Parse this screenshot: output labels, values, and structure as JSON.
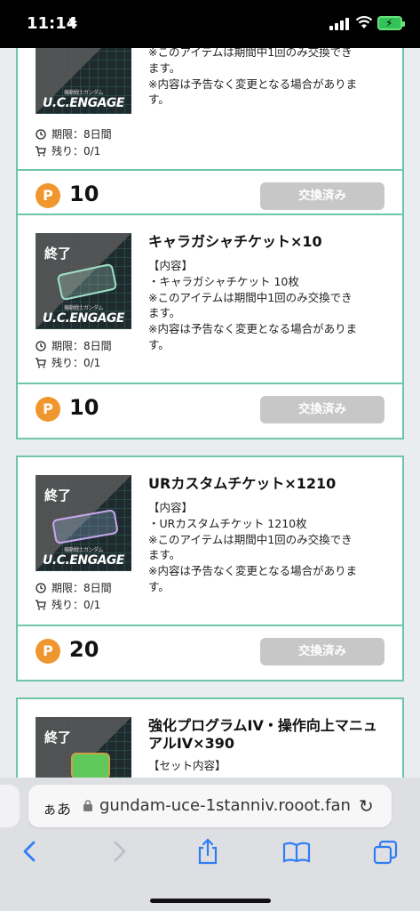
{
  "status": {
    "time": "11:14"
  },
  "cards": [
    {
      "id": "card1",
      "thumb_end_label": "",
      "thumb_logo": "U.C.ENGAGE",
      "thumb_logo_small": "機動戦士ガンダム",
      "title": "",
      "desc": [
        "※このアイテムは期間中1回のみ交換でき",
        "ます。",
        "※内容は予告なく変更となる場合がありま",
        "す。"
      ],
      "period": "期限：8日間",
      "remaining": "残り：0/1",
      "points": "10",
      "button": "交換済み"
    },
    {
      "id": "card2",
      "thumb_end_label": "終了",
      "thumb_logo": "U.C.ENGAGE",
      "thumb_logo_small": "機動戦士ガンダム",
      "title": "キャラガシャチケット×10",
      "desc": [
        "【内容】",
        "・キャラガシャチケット 10枚",
        "※このアイテムは期間中1回のみ交換でき",
        "ます。",
        "※内容は予告なく変更となる場合がありま",
        "す。"
      ],
      "period": "期限：8日間",
      "remaining": "残り：0/1",
      "points": "10",
      "button": "交換済み"
    },
    {
      "id": "card3",
      "thumb_end_label": "終了",
      "thumb_logo": "U.C.ENGAGE",
      "thumb_logo_small": "機動戦士ガンダム",
      "title": "URカスタムチケット×1210",
      "desc": [
        "【内容】",
        "・URカスタムチケット 1210枚",
        "※このアイテムは期間中1回のみ交換でき",
        "ます。",
        "※内容は予告なく変更となる場合がありま",
        "す。"
      ],
      "period": "期限：8日間",
      "remaining": "残り：0/1",
      "points": "20",
      "button": "交換済み"
    },
    {
      "id": "card4",
      "thumb_end_label": "終了",
      "title_line1": "強化プログラムIV・操作向上マニュ",
      "title_line2": "アルIV×390",
      "desc_first": "【セット内容】"
    }
  ],
  "browser": {
    "aa": "ぁあ",
    "url": "gundam-uce-1stanniv.rooot.fan"
  },
  "colors": {
    "accent": "#6ec5a8",
    "points": "#f0962e",
    "disabled_button": "#c7c7c7",
    "link": "#2f7df6"
  }
}
